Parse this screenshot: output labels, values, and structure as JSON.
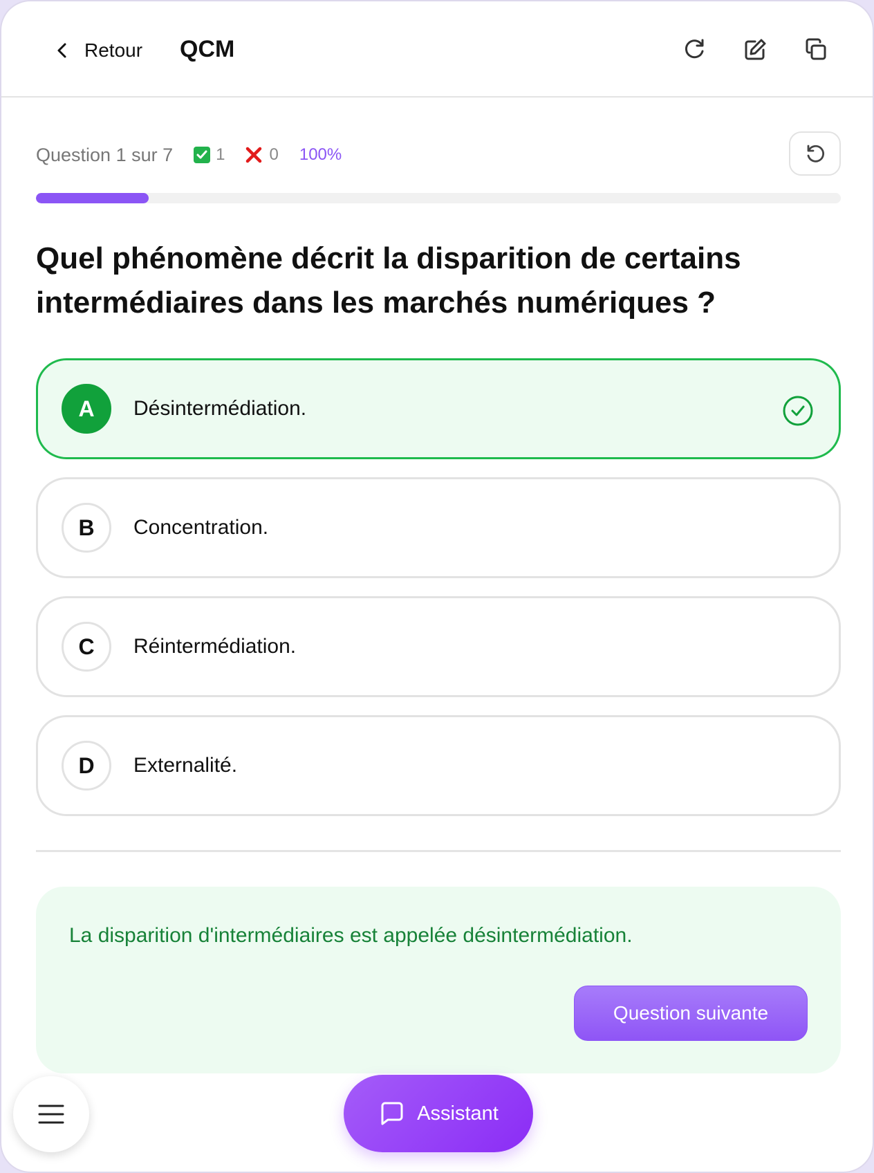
{
  "header": {
    "back_label": "Retour",
    "title": "QCM"
  },
  "stats": {
    "question_label": "Question 1 sur 7",
    "correct_count": "1",
    "wrong_count": "0",
    "percent": "100%",
    "progress_fraction": 0.14
  },
  "question": {
    "text": "Quel phénomène décrit la disparition de certains intermédiaires dans les marchés numériques ?"
  },
  "options": [
    {
      "letter": "A",
      "text": "Désintermédiation.",
      "state": "correct"
    },
    {
      "letter": "B",
      "text": "Concentration.",
      "state": "neutral"
    },
    {
      "letter": "C",
      "text": "Réintermédiation.",
      "state": "neutral"
    },
    {
      "letter": "D",
      "text": "Externalité.",
      "state": "neutral"
    }
  ],
  "feedback": {
    "text": "La disparition d'intermédiaires est appelée désintermédiation.",
    "next_label": "Question suivante"
  },
  "footer": {
    "assistant_label": "Assistant"
  },
  "colors": {
    "accent": "#8b55f5",
    "correct": "#1fba4d",
    "correct_bg": "#edfbf1",
    "feedback_text": "#178238"
  }
}
